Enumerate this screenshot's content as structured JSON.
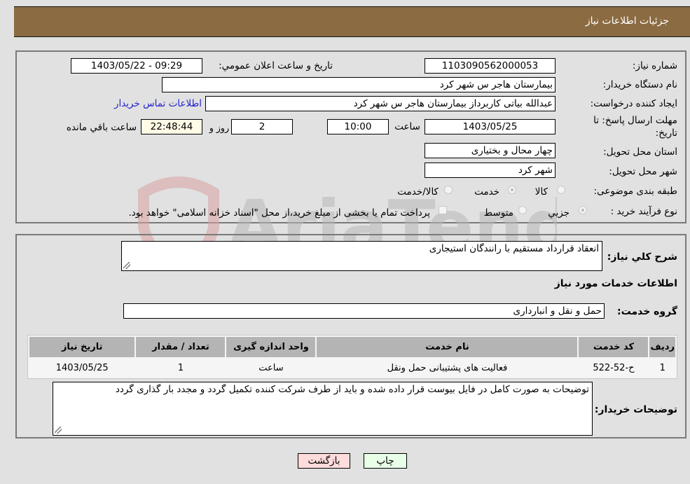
{
  "header": {
    "title": "جزئیات اطلاعات نیاز"
  },
  "fields": {
    "need_number": {
      "label": "شماره نیاز:",
      "value": "1103090562000053"
    },
    "announce_datetime": {
      "label": "تاریخ و ساعت اعلان عمومي:",
      "value": "1403/05/22 - 09:29"
    },
    "buyer_org": {
      "label": "نام دستگاه خریدار:",
      "value": "بیمارستان هاجر س  شهر کرد"
    },
    "requester": {
      "label": "ایجاد کننده درخواست:",
      "value": "عبدالله بیاتی کاربرداز بیمارستان هاجر س  شهر کرد"
    },
    "contact_link": "اطلاعات تماس خریدار",
    "deadline": {
      "label_line1": "مهلت ارسال پاسخ: تا",
      "label_line2": "تاریخ:",
      "date": "1403/05/25",
      "time_label": "ساعت",
      "time": "10:00",
      "days": "2",
      "days_label": "روز و",
      "remaining": "22:48:44",
      "remaining_label": "ساعت باقي مانده"
    },
    "province": {
      "label": "استان محل تحویل:",
      "value": "چهار محال و بختیاری"
    },
    "city": {
      "label": "شهر محل تحویل:",
      "value": "شهر کرد"
    },
    "category": {
      "label": "طبقه بندی موضوعی:",
      "options": [
        {
          "label": "کالا",
          "selected": false
        },
        {
          "label": "خدمت",
          "selected": true
        },
        {
          "label": "کالا/خدمت",
          "selected": false
        }
      ]
    },
    "purchase_type": {
      "label": "نوع فرآیند خرید :",
      "options": [
        {
          "label": "جزيي",
          "selected": true
        },
        {
          "label": "متوسط",
          "selected": false
        }
      ],
      "treasury_checkbox": {
        "label": "پرداخت تمام یا بخشی از مبلغ خرید،از محل \"اسناد خزانه اسلامی\" خواهد بود.",
        "checked": false
      }
    }
  },
  "description": {
    "label": "شرح کلي نیاز:",
    "value": "انعقاد قرارداد مستقیم با رانندگان استیجاری"
  },
  "services_section_title": "اطلاعات خدمات مورد نیاز",
  "service_group": {
    "label": "گروه خدمت:",
    "value": "حمل و نقل و انبارداری"
  },
  "services_table": {
    "columns": [
      "ردیف",
      "کد خدمت",
      "نام خدمت",
      "واحد اندازه گیری",
      "تعداد / مقدار",
      "تاریخ نیاز"
    ],
    "rows": [
      [
        "1",
        "ح-52-522",
        "فعالیت های پشتیبانی حمل ونقل",
        "ساعت",
        "1",
        "1403/05/25"
      ]
    ]
  },
  "buyer_notes": {
    "label": "توضیحات خریدار:",
    "value": "توضیحات به صورت کامل در فایل بیوست قرار داده شده و باید از طرف شرکت کننده تکمیل گردد و مجدد بار گذاری گردد"
  },
  "buttons": {
    "print": "چاپ",
    "back": "بازگشت"
  },
  "watermark": {
    "text": "AriaTender.neT",
    "brand_color": "#d9a3a3"
  }
}
